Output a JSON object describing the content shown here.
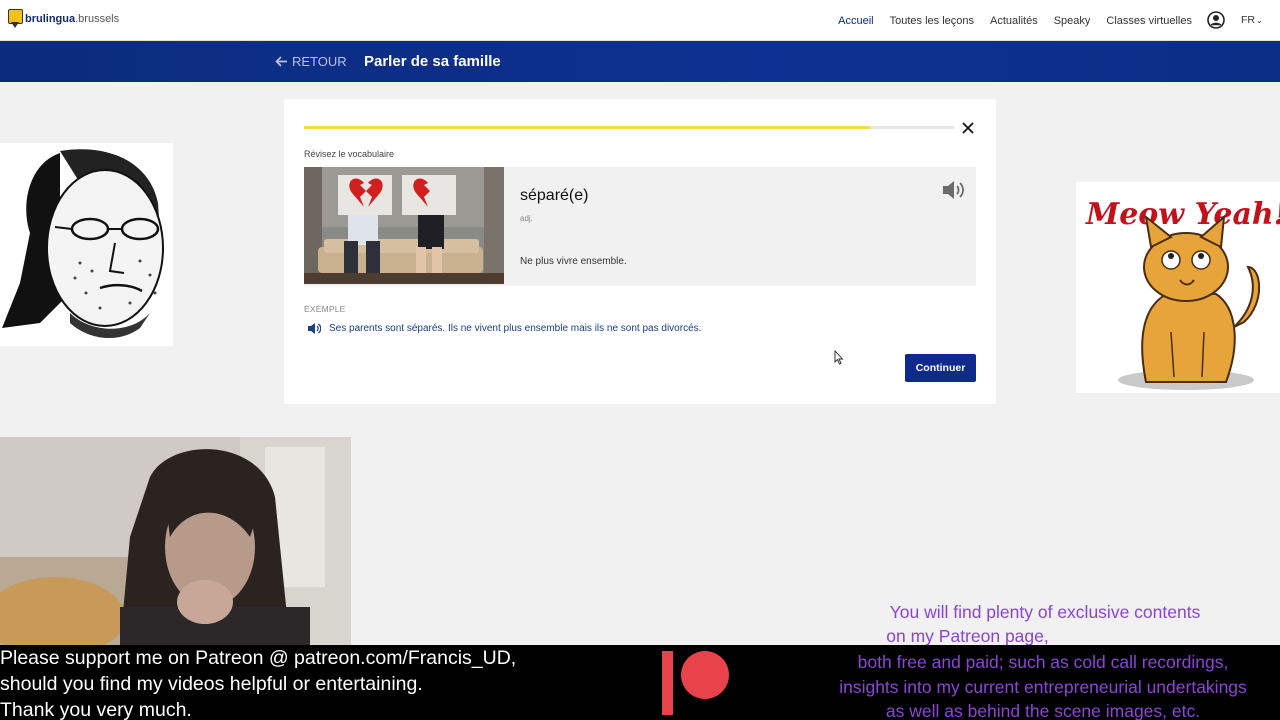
{
  "nav": {
    "logo_main": "brulingua",
    "logo_sub": ".brussels",
    "links": [
      "Accueil",
      "Toutes les leçons",
      "Actualités",
      "Speaky",
      "Classes virtuelles"
    ],
    "lang": "FR"
  },
  "header": {
    "back_label": "RETOUR",
    "title": "Parler de sa famille"
  },
  "lesson": {
    "progress_percent": 87,
    "section_label": "Révisez le vocabulaire",
    "word": "séparé(e)",
    "pos": "adj.",
    "definition": "Ne plus vivre ensemble.",
    "example_label": "EXEMPLE",
    "example_text": "Ses parents sont séparés. Ils ne vivent plus ensemble mais ils ne sont pas divorcés.",
    "continue_label": "Continuer"
  },
  "overlay": {
    "cat_caption": "Meow Yeah!",
    "promo_top": [
      "You will find plenty of exclusive contents",
      "on my Patreon page,"
    ],
    "support_lines": [
      "Please support me on Patreon @ patreon.com/Francis_UD,",
      "should you find my videos helpful or entertaining.",
      "Thank you very much."
    ],
    "promo_bottom": [
      "both free and paid; such as cold call recordings,",
      "insights into my current entrepreneurial undertakings",
      "as well as behind the scene images, etc."
    ]
  },
  "colors": {
    "brand_blue": "#0e2a8a",
    "progress_yellow": "#f3dc4a",
    "promo_purple": "#8a45d6"
  }
}
